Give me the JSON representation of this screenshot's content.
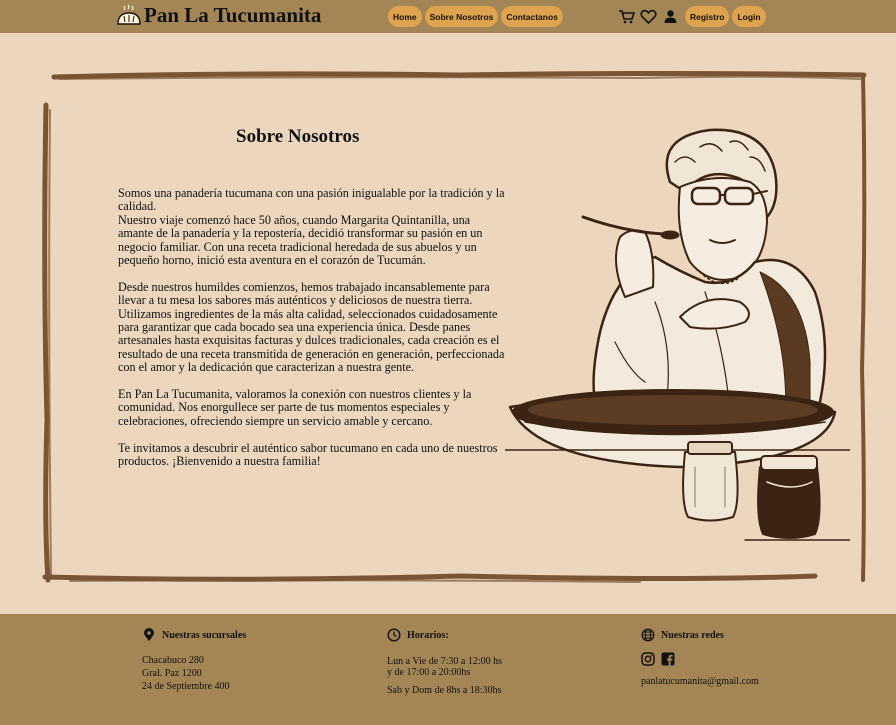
{
  "header": {
    "brand": "Pan La Tucumanita",
    "nav": [
      "Home",
      "Sobre Nosotros",
      "Contactanos"
    ],
    "icons": [
      "cart-icon",
      "heart-icon",
      "user-icon"
    ],
    "auth": [
      "Registro",
      "Login"
    ]
  },
  "main": {
    "title": "Sobre Nosotros",
    "paragraphs": [
      "Somos una panadería tucumana con una pasión inigualable por la tradición y la calidad.\nNuestro viaje comenzó hace 50 años, cuando Margarita Quintanilla, una amante de la panadería y la repostería, decidió transformar su pasión en un negocio familiar. Con una receta tradicional heredada de sus abuelos y un pequeño horno, inició esta aventura en el corazón de Tucumán.",
      "Desde nuestros humildes comienzos, hemos trabajado incansablemente para llevar a tu mesa los sabores más auténticos y deliciosos de nuestra tierra. Utilizamos ingredientes de la más alta calidad, seleccionados cuidadosamente para garantizar que cada bocado sea una experiencia única. Desde panes artesanales hasta exquisitas facturas y dulces tradicionales, cada creación es el resultado de una receta transmitida de generación en generación, perfeccionada con el amor y la dedicación que caracterizan a nuestra gente.",
      "En Pan La Tucumanita, valoramos la conexión con nuestros clientes y la comunidad. Nos enorgullece ser parte de tus momentos especiales y celebraciones, ofreciendo siempre un servicio amable y cercano.",
      "Te invitamos a descubrir el auténtico sabor tucumano en cada uno de nuestros productos. ¡Bienvenido a nuestra familia!"
    ]
  },
  "footer": {
    "branches": {
      "title": "Nuestras sucursales",
      "lines": [
        "Chacabuco 280",
        "Gral. Paz 1200",
        "24 de Septiembre 400"
      ]
    },
    "hours": {
      "title": "Horarios:",
      "weekday": [
        "Lun a Vie de 7:30 a 12:00 hs",
        "y de 17:00 a 20:00hs"
      ],
      "weekend": "Sab y Dom de 8hs a 18:30hs"
    },
    "social": {
      "title": "Nuestras redes",
      "email": "panlatucumanita@gmail.com"
    }
  },
  "colors": {
    "header_bg": "#a48656",
    "page_bg": "#ecd6bd",
    "pill_bg": "#dda34e",
    "frame_brown": "#7a5535"
  }
}
